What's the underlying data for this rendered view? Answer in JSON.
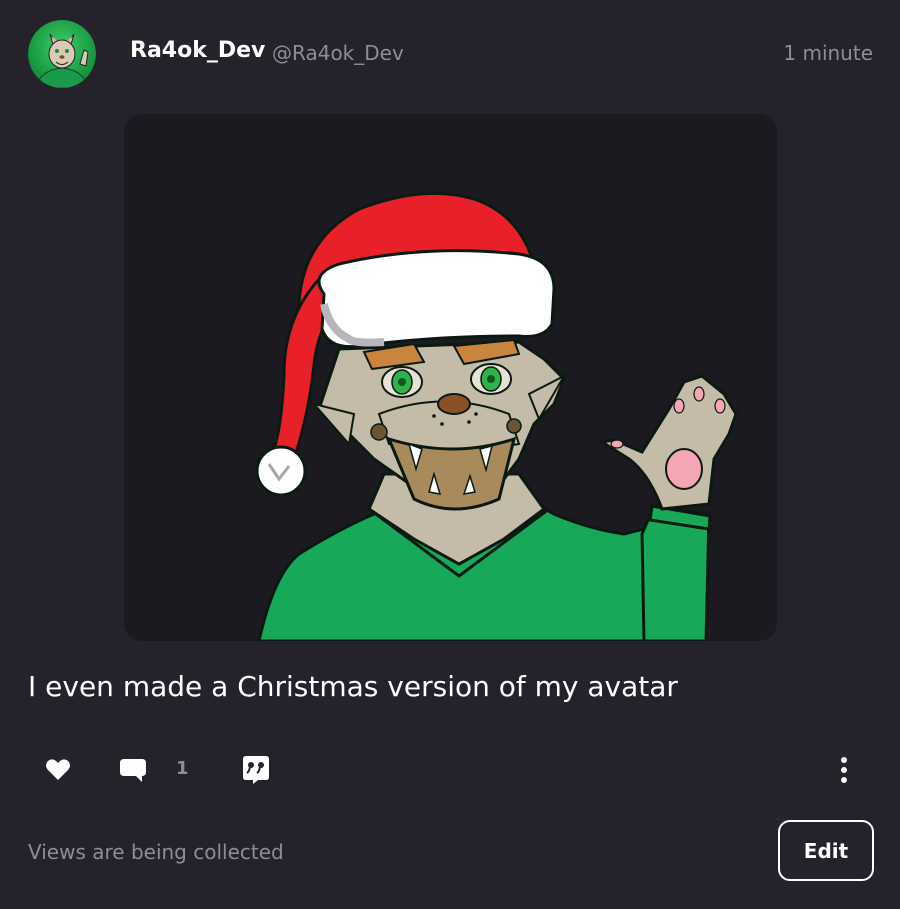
{
  "author": {
    "display_name": "Ra4ok_Dev",
    "handle": "@Ra4ok_Dev"
  },
  "timestamp": "1 minute",
  "post": {
    "text": "I even made a Christmas version of my avatar",
    "image_alt_icon": "christmas-avatar-illustration"
  },
  "actions": {
    "like_icon": "heart-icon",
    "comment_icon": "speech-bubble-icon",
    "comment_count": "1",
    "share_icon": "quote-bubble-icon",
    "more_icon": "vertical-ellipsis-icon"
  },
  "footer": {
    "views_text": "Views are being collected",
    "edit_label": "Edit"
  },
  "colors": {
    "background": "#25222c",
    "muted_text": "#8f8c97",
    "image_background": "#1c1a21",
    "santa_hat_red": "#e8202a",
    "sweater_green": "#17a85a",
    "fur": "#c4bba8"
  }
}
